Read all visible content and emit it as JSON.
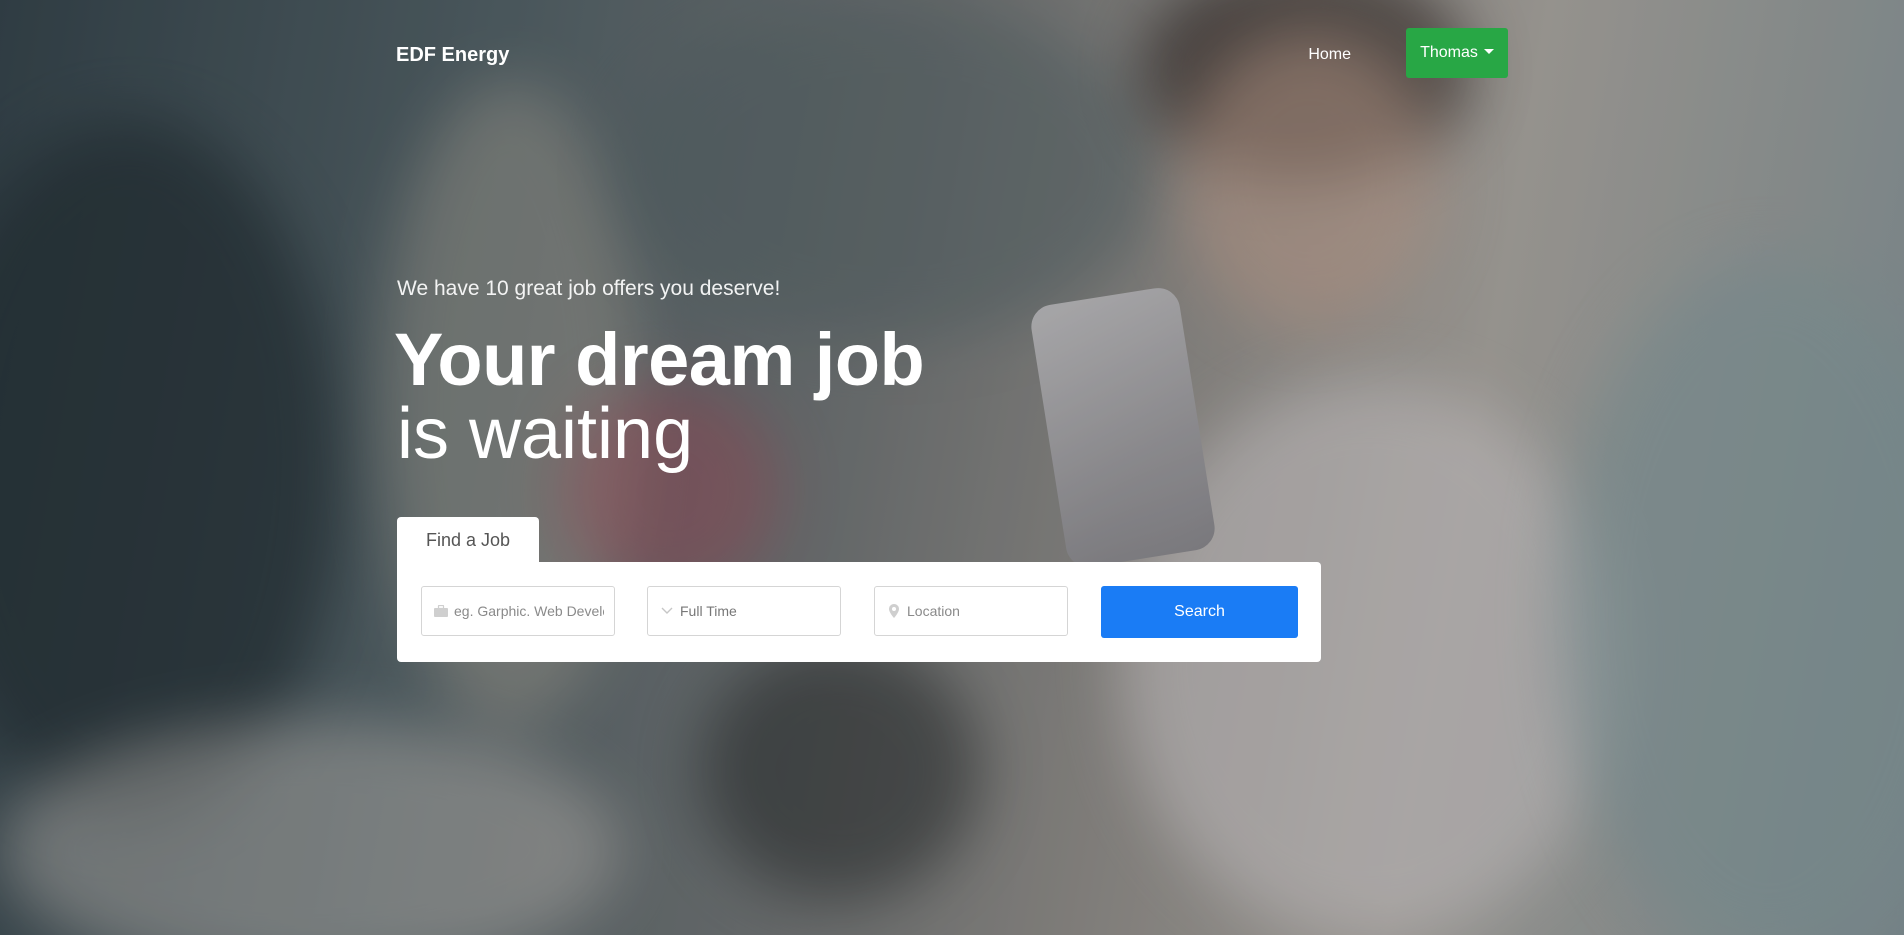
{
  "navbar": {
    "brand": "EDF Energy",
    "home_label": "Home",
    "user_label": "Thomas"
  },
  "hero": {
    "tagline": "We have 10 great job offers you deserve!",
    "headline_bold": "Your dream job",
    "headline_light": "is waiting"
  },
  "search": {
    "tab_label": "Find a Job",
    "keyword_placeholder": "eg. Garphic. Web Developer",
    "job_type_value": "Full Time",
    "location_placeholder": "Location",
    "button_label": "Search"
  },
  "colors": {
    "user_button": "#28a745",
    "search_button": "#1a7cf5"
  }
}
